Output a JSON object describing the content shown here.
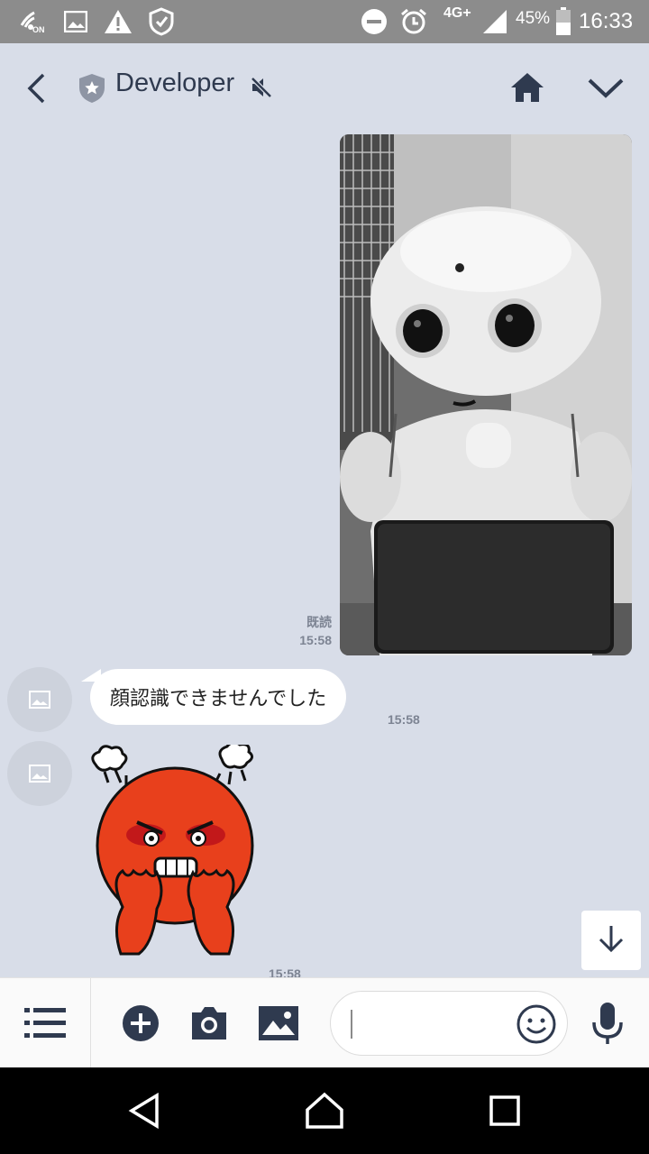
{
  "status_bar": {
    "network_type": "4G+",
    "battery_percent": "45%",
    "time": "16:33",
    "nfc_label": "ON",
    "left_icons": [
      "nfc-icon",
      "image-notification-icon",
      "warning-icon",
      "shield-icon"
    ],
    "right_icons": [
      "do-not-disturb-icon",
      "alarm-icon",
      "signal-icon",
      "battery-icon"
    ]
  },
  "header": {
    "title": "Developer",
    "icons": [
      "back-icon",
      "official-badge-icon",
      "mute-icon",
      "home-icon",
      "chevron-down-icon"
    ]
  },
  "messages": [
    {
      "type": "image",
      "sender": "self",
      "read_label": "既読",
      "time": "15:58"
    },
    {
      "type": "text",
      "sender": "other",
      "text": "顔認識できませんでした",
      "time": "15:58"
    },
    {
      "type": "sticker",
      "sender": "other",
      "sticker": "angry-face-sticker",
      "time": "15:58"
    }
  ],
  "input_bar": {
    "message_value": "",
    "icons": [
      "menu-icon",
      "plus-icon",
      "camera-icon",
      "gallery-icon",
      "emoji-icon",
      "mic-icon"
    ]
  },
  "colors": {
    "background": "#d8dde8",
    "accent_dark": "#2f3a4f",
    "sticker_red": "#e8401c"
  }
}
